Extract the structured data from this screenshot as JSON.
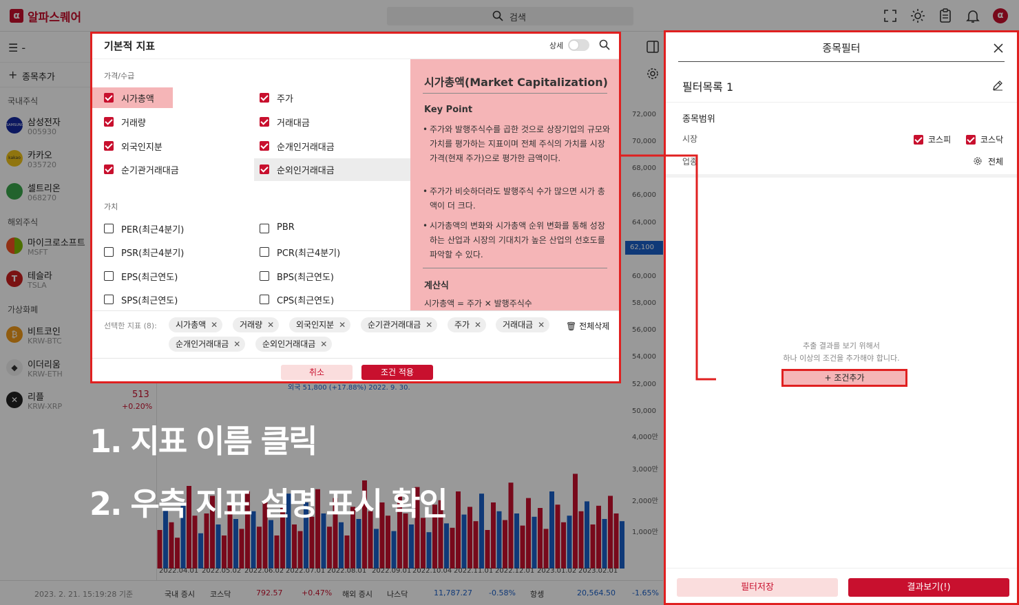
{
  "app": {
    "title": "알파스퀘어",
    "logo": "α",
    "search_placeholder": "검색"
  },
  "sidebar": {
    "add_stock": "종목추가",
    "sections": [
      {
        "title": "국내주식",
        "items": [
          {
            "name": "삼성전자",
            "code": "005930",
            "logo": "SAMSUNG",
            "color": "#1428a0"
          },
          {
            "name": "카카오",
            "code": "035720",
            "logo": "kakao",
            "color": "#f0c419"
          },
          {
            "name": "셀트리온",
            "code": "068270",
            "logo": "",
            "color": "#3aa64c"
          }
        ]
      },
      {
        "title": "해외주식",
        "items": [
          {
            "name": "마이크로소프트",
            "code": "MSFT",
            "logo": "",
            "color": "#737373"
          },
          {
            "name": "테슬라",
            "code": "TSLA",
            "logo": "T",
            "color": "#cc1f1f"
          }
        ]
      },
      {
        "title": "가상화폐",
        "items": [
          {
            "name": "비트코인",
            "code": "KRW-BTC",
            "logo": "₿",
            "color": "#f09a1a"
          },
          {
            "name": "이더리움",
            "code": "KRW-ETH",
            "logo": "◆",
            "color": "#eeeeee"
          },
          {
            "name": "리플",
            "code": "KRW-XRP",
            "logo": "✕",
            "color": "#222222"
          }
        ]
      }
    ],
    "xrp_price": "513",
    "xrp_change": "+0.20%"
  },
  "chart": {
    "price_ticks": [
      "72,000",
      "70,000",
      "68,000",
      "66,000",
      "64,000",
      "62,100",
      "60,000",
      "58,000",
      "56,000",
      "54,000",
      "52,000",
      "50,000"
    ],
    "volume_ticks": [
      "4,000만",
      "3,000만",
      "2,000만",
      "1,000만"
    ],
    "x_labels": [
      "2022.04.01",
      "2022.05.02",
      "2022.06.02",
      "2022.07.01",
      "2022.08.01",
      "2022.09.01",
      "2022.10.04",
      "2022.11.01",
      "2022.12.01",
      "2023.01.02",
      "2023.02.01"
    ],
    "bars": [
      0.35,
      0.55,
      0.42,
      0.28,
      0.6,
      0.75,
      0.48,
      0.32,
      0.5,
      0.66,
      0.4,
      0.3,
      0.58,
      0.45,
      0.36,
      0.7,
      0.52,
      0.38,
      0.62,
      0.44,
      0.3,
      0.55,
      0.68,
      0.4,
      0.34,
      0.6,
      0.47,
      0.72,
      0.5,
      0.38,
      0.64,
      0.42,
      0.3,
      0.56,
      0.45,
      0.8,
      0.52,
      0.36,
      0.6,
      0.48,
      0.34,
      0.66,
      0.5,
      0.4,
      0.74,
      0.46,
      0.33,
      0.58,
      0.62,
      0.41,
      0.37,
      0.7,
      0.49,
      0.56,
      0.43,
      0.68,
      0.35,
      0.6,
      0.52,
      0.44,
      0.78,
      0.5,
      0.39,
      0.64,
      0.47,
      0.55,
      0.36,
      0.7,
      0.58,
      0.42,
      0.48,
      0.86,
      0.52,
      0.61,
      0.4,
      0.57,
      0.45,
      0.66,
      0.5,
      0.43
    ],
    "partial_label": "외국 51,800 (+17.88%) 2022. 9. 30."
  },
  "modal": {
    "title": "기본적 지표",
    "detail_label": "상세",
    "sections": [
      {
        "label": "가격/수급",
        "items": [
          {
            "label": "시가총액",
            "checked": true
          },
          {
            "label": "주가",
            "checked": true
          },
          {
            "label": "거래량",
            "checked": true
          },
          {
            "label": "거래대금",
            "checked": true
          },
          {
            "label": "외국인지분",
            "checked": true
          },
          {
            "label": "순개인거래대금",
            "checked": true
          },
          {
            "label": "순기관거래대금",
            "checked": true
          },
          {
            "label": "순외인거래대금",
            "checked": true
          }
        ]
      },
      {
        "label": "가치",
        "items": [
          {
            "label": "PER(최근4분기)",
            "checked": false
          },
          {
            "label": "PBR",
            "checked": false
          },
          {
            "label": "PSR(최근4분기)",
            "checked": false
          },
          {
            "label": "PCR(최근4분기)",
            "checked": false
          },
          {
            "label": "EPS(최근연도)",
            "checked": false
          },
          {
            "label": "BPS(최근연도)",
            "checked": false
          },
          {
            "label": "SPS(최근연도)",
            "checked": false
          },
          {
            "label": "CPS(최근연도)",
            "checked": false
          }
        ]
      }
    ],
    "description": {
      "title": "시가총액(Market Capitalization)",
      "key_point": "Key Point",
      "bullets": [
        "주가와 발행주식수를 곱한 것으로 상장기업의 규모와 가치를 평가하는 지표이며 전체 주식의 가치를 시장가격(현재 주가)으로 평가한 금액이다.",
        "주가가 비슷하더라도 발행주식 수가 많으면 시가 총액이 더 크다.",
        "시가총액의 변화와 시가총액 순위 변화를 통해 성장하는 산업과 시장의 기대치가 높은 산업의 선호도를 파악할 수 있다."
      ],
      "formula_title": "계산식",
      "formula": "시가총액 = 주가 ✕ 발행주식수"
    },
    "selected_label": "선택한 지표 (8):",
    "chips": [
      "시가총액",
      "거래량",
      "외국인지분",
      "순기관거래대금",
      "주가",
      "거래대금",
      "순개인거래대금",
      "순외인거래대금"
    ],
    "clear_all": "전체삭제",
    "cancel": "취소",
    "apply": "조건 적용"
  },
  "filter": {
    "title": "종목필터",
    "list_name": "필터목록 1",
    "scope_title": "종목범위",
    "market_label": "시장",
    "kospi": "코스피",
    "kosdaq": "코스닥",
    "industry_label": "업종",
    "industry_value": "전체",
    "empty_line1": "추출 결과를 보기 위해서",
    "empty_line2": "하나 이상의 조건을 추가해야 합니다.",
    "add_condition": "조건추가",
    "save": "필터저장",
    "results": "결과보기(!)"
  },
  "status": {
    "timestamp": "2023. 2. 21. 15:19:28 기준",
    "domestic": "국내 증시",
    "kosdaq": "코스닥",
    "kosdaq_value": "792.57",
    "kosdaq_change": "+0.47%",
    "overseas": "해외 증시",
    "nasdaq": "나스닥",
    "nasdaq_value": "11,787.27",
    "nasdaq_change": "-0.58%",
    "hangseng": "항셍",
    "hangseng_value": "20,564.50",
    "hangseng_change": "-1.65%"
  },
  "annotations": [
    "1. 지표 이름 클릭",
    "2. 우측 지표 설명 표시 확인"
  ],
  "colors": {
    "brand": "#c8102e",
    "highlight": "#e02020",
    "desc_bg": "#f5b5b7",
    "up": "#c8102e",
    "down": "#1a5fc8"
  }
}
